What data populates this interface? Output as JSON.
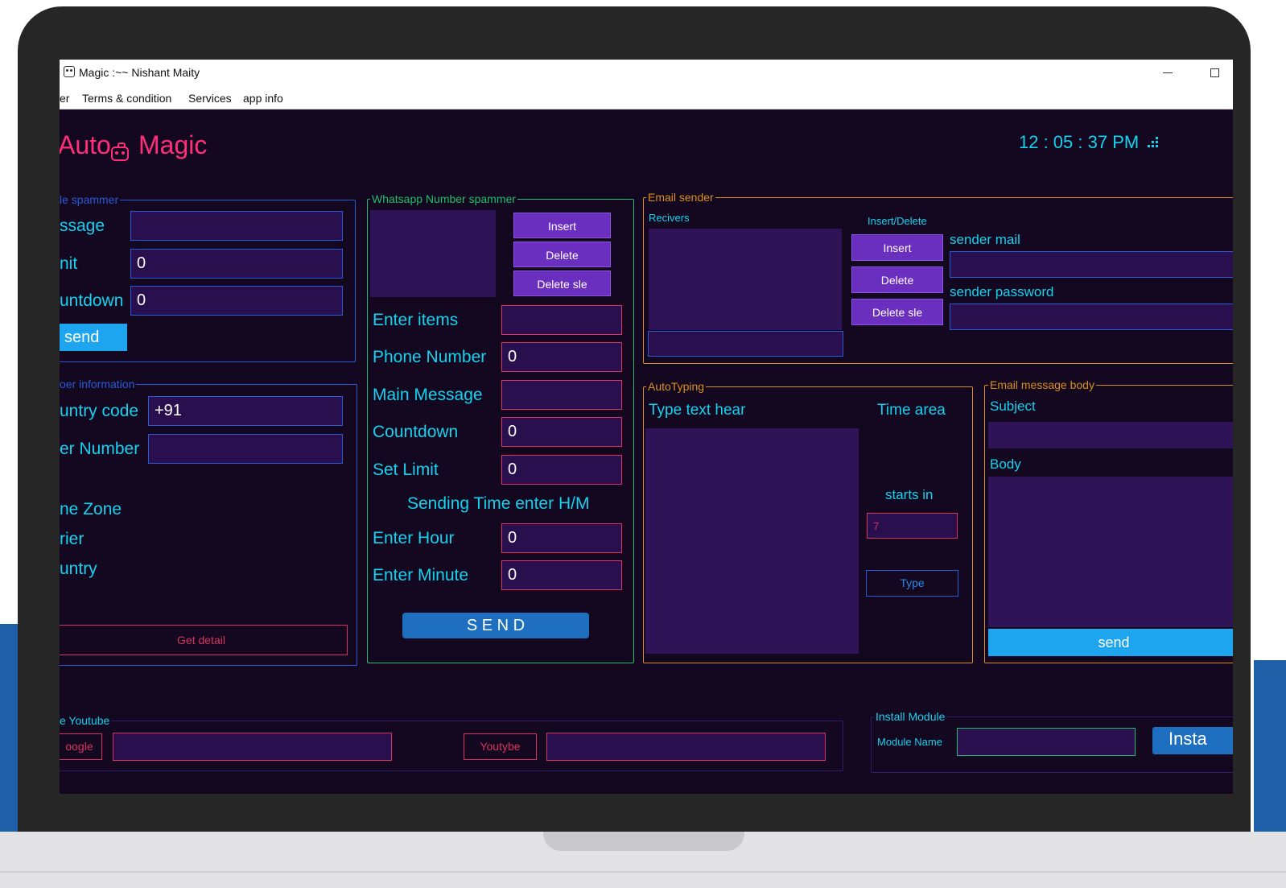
{
  "window": {
    "title": "Magic :~~ Nishant Maity"
  },
  "menu": {
    "items": [
      "er",
      "Terms & condition",
      "Services",
      "app info"
    ]
  },
  "header": {
    "brand_left": "Auto",
    "brand_right": "Magic",
    "clock": "12 : 05 : 37 PM"
  },
  "message_spammer": {
    "legend": "le spammer",
    "message_label": "ssage",
    "message_value": "",
    "limit_label": "nit",
    "limit_value": "0",
    "countdown_label": "untdown",
    "countdown_value": "0",
    "send_label": "send"
  },
  "number_info": {
    "legend": "oer information",
    "country_code_label": "untry code",
    "country_code_value": "+91",
    "number_label": "er Number",
    "number_value": "",
    "time_zone_label": "ne Zone",
    "carrier_label": "rier",
    "country_label": "untry",
    "get_detail_label": "Get detail"
  },
  "whatsapp": {
    "legend": "Whatsapp Number spammer",
    "insert_label": "Insert",
    "delete_label": "Delete",
    "delete_sel_label": "Delete sle",
    "enter_items_label": "Enter items",
    "enter_items_value": "",
    "phone_label": "Phone Number",
    "phone_value": "0",
    "main_message_label": "Main Message",
    "main_message_value": "",
    "countdown_label": "Countdown",
    "countdown_value": "0",
    "set_limit_label": "Set Limit",
    "set_limit_value": "0",
    "sending_time_label": "Sending Time enter H/M",
    "hour_label": "Enter Hour",
    "hour_value": "0",
    "minute_label": "Enter Minute",
    "minute_value": "0",
    "send_label": "S E N D"
  },
  "email_sender": {
    "legend": "Email sender",
    "receivers_label": "Recivers",
    "insert_delete_label": "Insert/Delete",
    "insert_label": "Insert",
    "delete_label": "Delete",
    "delete_sel_label": "Delete sle",
    "sender_mail_label": "sender mail",
    "sender_mail_value": "",
    "sender_password_label": "sender password",
    "sender_password_value": ""
  },
  "auto_typing": {
    "legend": "AutoTyping",
    "type_text_label": "Type text hear",
    "time_area_label": "Time area",
    "starts_in_label": "starts in",
    "starts_in_value": "7",
    "type_button_label": "Type"
  },
  "email_body": {
    "legend": "Email message body",
    "subject_label": "Subject",
    "subject_value": "",
    "body_label": "Body",
    "send_label": "send"
  },
  "youtube": {
    "legend": "e Youtube",
    "google_label": "oogle",
    "google_value": "",
    "youtube_label": "Youtybe",
    "youtube_value": ""
  },
  "install_module": {
    "legend": "Install Module",
    "module_name_label": "Module Name",
    "module_name_value": "",
    "install_label": "Insta"
  },
  "colors": {
    "background": "#13081f",
    "accent_cyan": "#15d2ef",
    "brand_pink": "#ff2e7a",
    "button_purple": "#6b2fc0",
    "button_blue": "#1ea5f0"
  }
}
